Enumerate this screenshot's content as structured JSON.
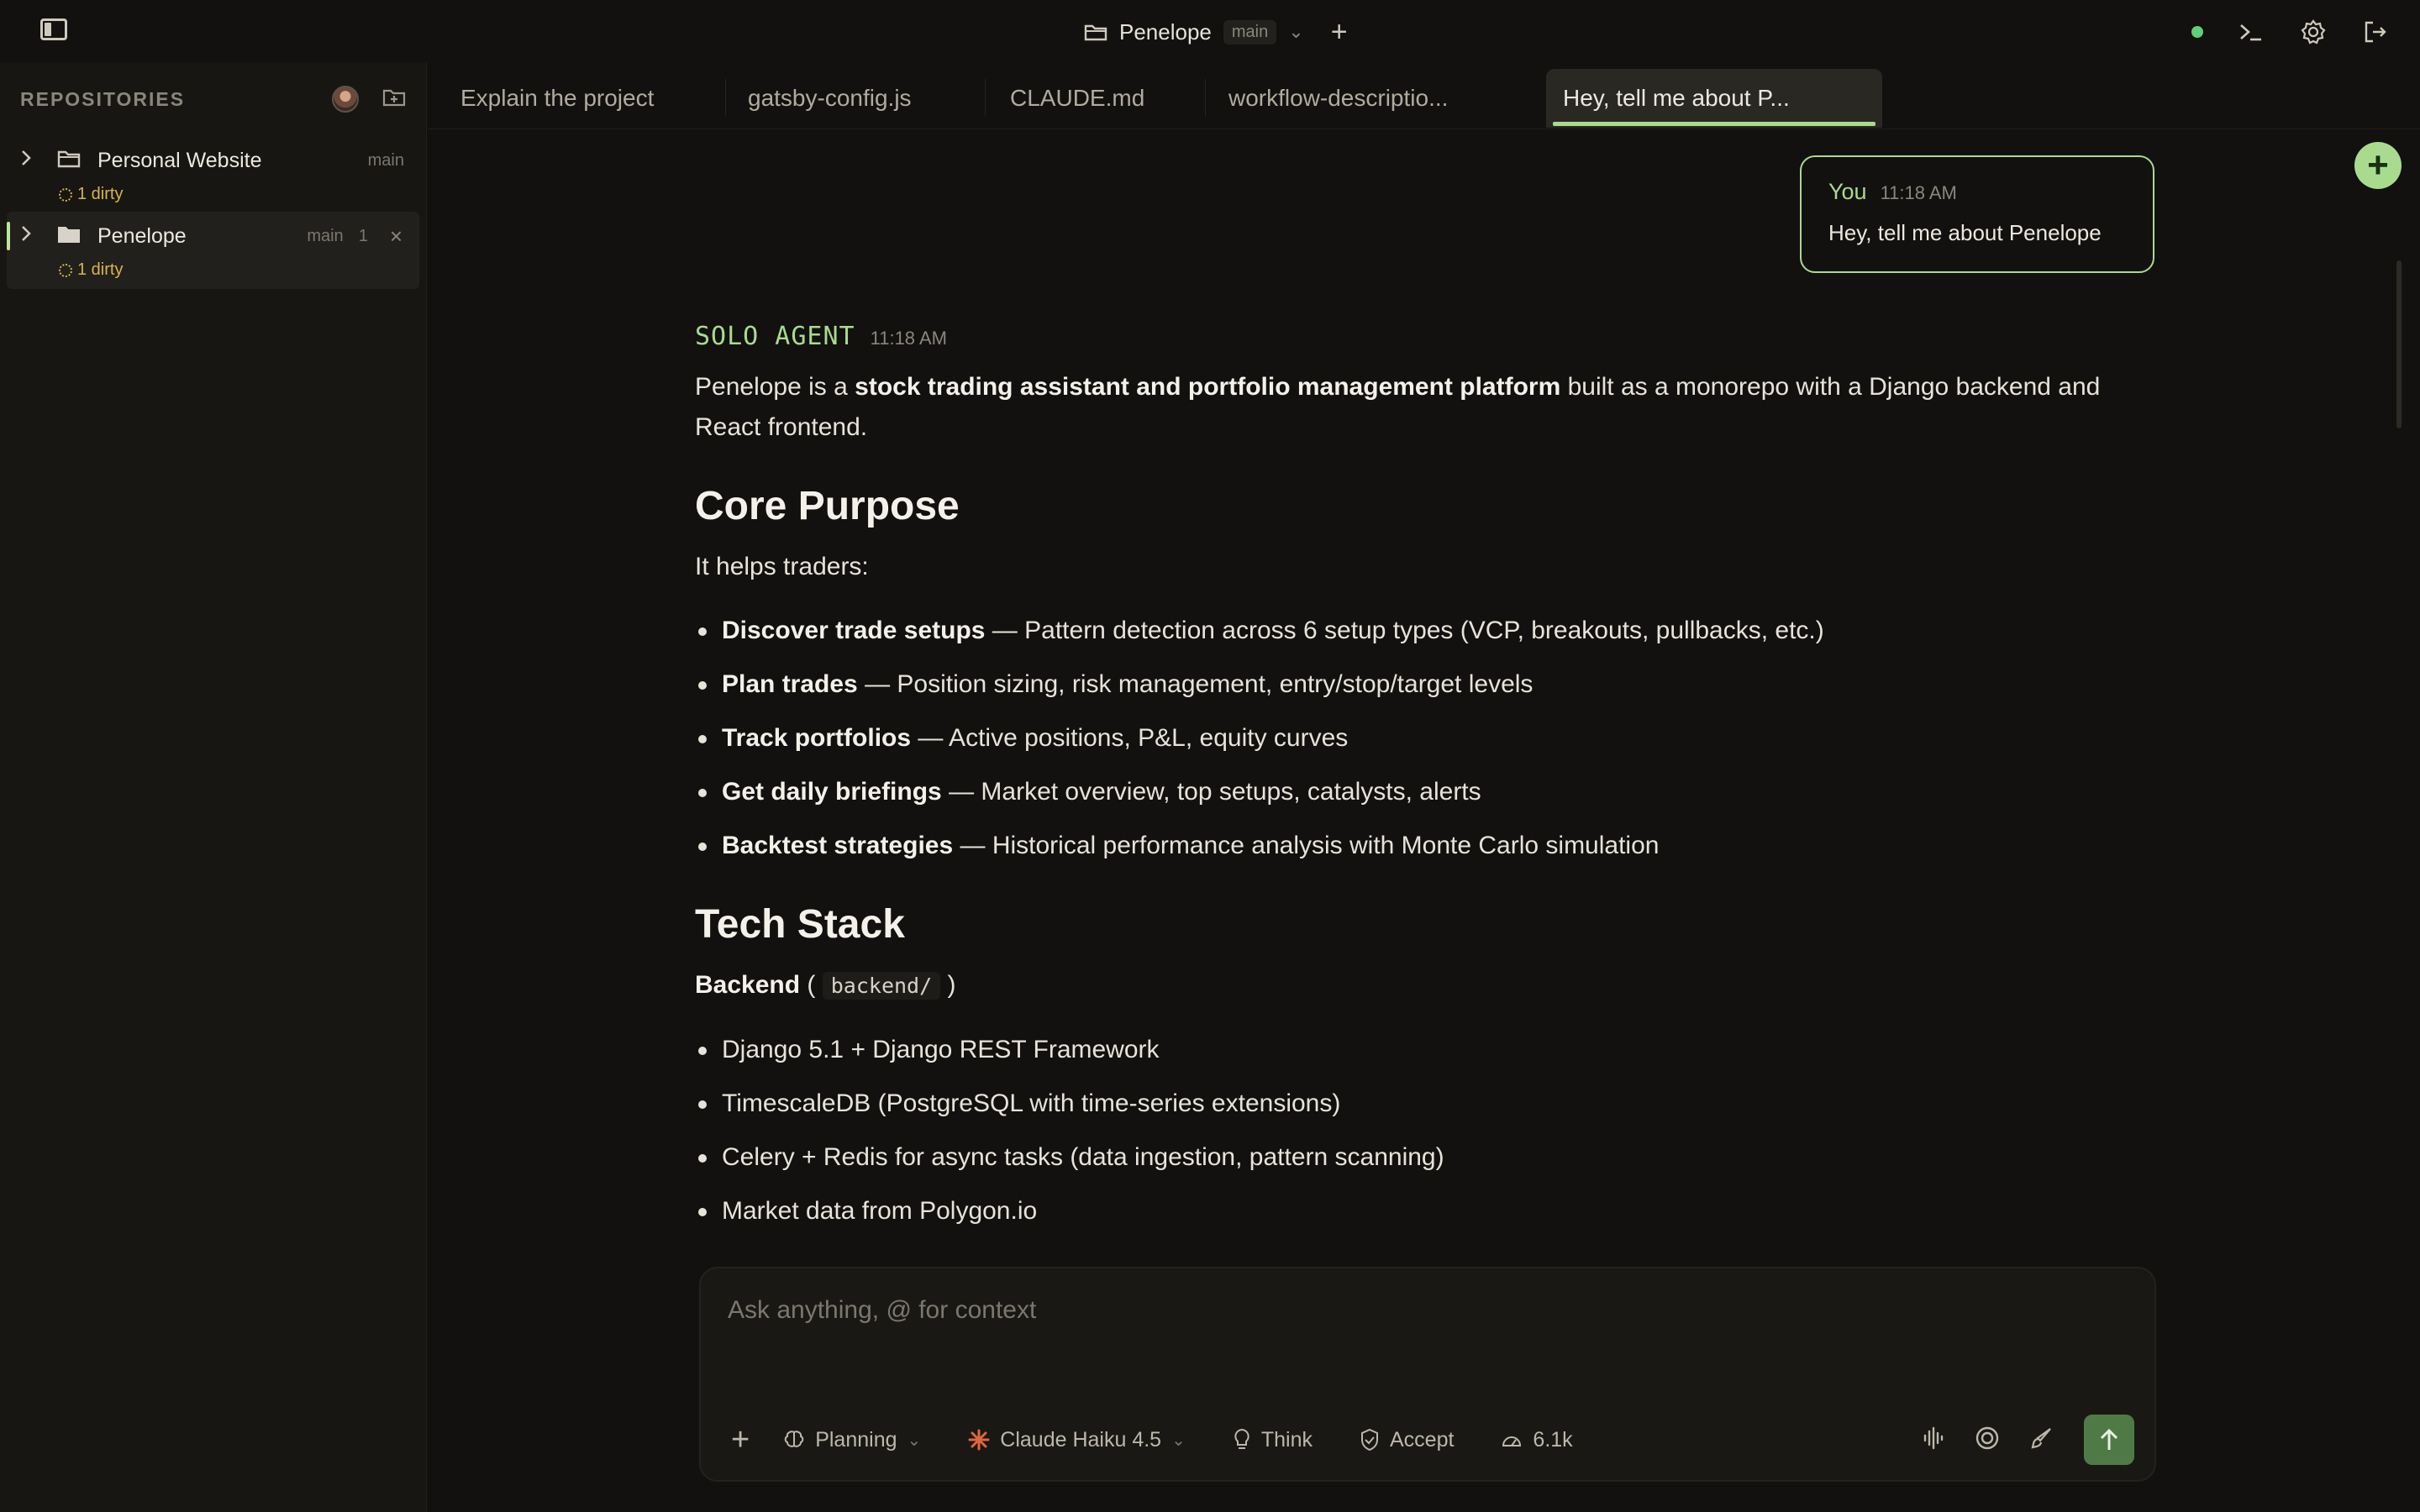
{
  "topbar": {
    "project_name": "Penelope",
    "branch": "main",
    "icons": [
      "sidebar-toggle-icon",
      "folder-icon",
      "chevron-down-icon",
      "plus-icon",
      "status-dot",
      "terminal-icon",
      "gear-icon",
      "logout-icon"
    ],
    "status_color": "#5fcf7a"
  },
  "sidebar": {
    "title": "REPOSITORIES",
    "repos": [
      {
        "name": "Personal Website",
        "branch": "main",
        "count": "",
        "dirty": "1 dirty",
        "active": false
      },
      {
        "name": "Penelope",
        "branch": "main",
        "count": "1",
        "dirty": "1 dirty",
        "active": true
      }
    ]
  },
  "tabs": [
    {
      "label": "Explain the project",
      "active": false
    },
    {
      "label": "gatsby-config.js",
      "active": false
    },
    {
      "label": "CLAUDE.md",
      "active": false
    },
    {
      "label": "workflow-descriptio...",
      "active": false
    },
    {
      "label": "Hey, tell me about P...",
      "active": true
    }
  ],
  "user_message": {
    "author": "You",
    "time": "11:18 AM",
    "text": "Hey, tell me about Penelope"
  },
  "agent": {
    "label": "SOLO AGENT",
    "time": "11:18 AM",
    "intro_pre": "Penelope is a ",
    "intro_bold": "stock trading assistant and portfolio management platform",
    "intro_post": " built as a monorepo with a Django backend and React frontend.",
    "h_core": "Core Purpose",
    "core_lead": "It helps traders:",
    "core_items": [
      {
        "bold": "Discover trade setups",
        "text": " — Pattern detection across 6 setup types (VCP, breakouts, pullbacks, etc.)"
      },
      {
        "bold": "Plan trades",
        "text": " — Position sizing, risk management, entry/stop/target levels"
      },
      {
        "bold": "Track portfolios",
        "text": " — Active positions, P&L, equity curves"
      },
      {
        "bold": "Get daily briefings",
        "text": " — Market overview, top setups, catalysts, alerts"
      },
      {
        "bold": "Backtest strategies",
        "text": " — Historical performance analysis with Monte Carlo simulation"
      }
    ],
    "h_tech": "Tech Stack",
    "backend_bold": "Backend",
    "backend_open": " ( ",
    "backend_code": "backend/",
    "backend_close": " )",
    "backend_items": [
      "Django 5.1 + Django REST Framework",
      "TimescaleDB (PostgreSQL with time-series extensions)",
      "Celery + Redis for async tasks (data ingestion, pattern scanning)",
      "Market data from Polygon.io"
    ]
  },
  "composer": {
    "placeholder": "Ask anything, @ for context",
    "mode": "Planning",
    "model": "Claude Haiku 4.5",
    "think": "Think",
    "accept": "Accept",
    "tokens": "6.1k",
    "accent": "#a9db8e",
    "model_icon_color": "#e0673a"
  }
}
